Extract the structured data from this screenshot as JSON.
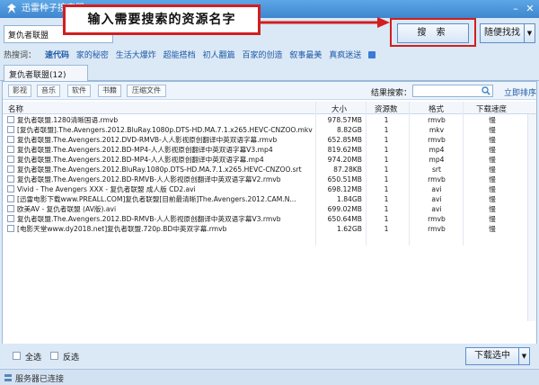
{
  "window": {
    "title": "迅雷种子搜索器",
    "minimize_icon": "minimize-icon",
    "close_icon": "close-icon"
  },
  "search": {
    "input_value": "复仇者联盟",
    "callout_text": "输入需要搜索的资源名字",
    "search_button": "搜 索",
    "random_button": "随便找找"
  },
  "hot": {
    "label": "热搜词：",
    "items": [
      "速代码",
      "家的秘密",
      "生活大爆炸",
      "超能搭档",
      "初人翻篇",
      "百家的创造",
      "叙事最美",
      "真疯迷送"
    ]
  },
  "tab": {
    "label": "复仇者联盟(12)"
  },
  "filters": {
    "buttons": [
      "影视",
      "音乐",
      "软件",
      "书籍",
      "压缩文件"
    ],
    "result_label": "结果搜索：",
    "sort_link": "立即排序"
  },
  "table": {
    "headers": {
      "name": "名称",
      "size": "大小",
      "count": "资源数",
      "format": "格式",
      "speed": "下载速度"
    },
    "rows": [
      {
        "name": "复仇者联盟.1280清晰国语.rmvb",
        "size": "978.57MB",
        "count": "1",
        "format": "rmvb",
        "speed": "慢"
      },
      {
        "name": "[复仇者联盟].The.Avengers.2012.BluRay.1080p.DTS-HD.MA.7.1.x265.HEVC-CNZOO.mkv",
        "size": "8.82GB",
        "count": "1",
        "format": "mkv",
        "speed": "慢"
      },
      {
        "name": "复仇者联盟.The.Avengers.2012.DVD-RMVB-人人影视原创翻译中英双语字幕.rmvb",
        "size": "652.85MB",
        "count": "1",
        "format": "rmvb",
        "speed": "慢"
      },
      {
        "name": "复仇者联盟.The.Avengers.2012.BD-MP4-人人影视原创翻译中英双语字幕V3.mp4",
        "size": "819.62MB",
        "count": "1",
        "format": "mp4",
        "speed": "慢"
      },
      {
        "name": "复仇者联盟.The.Avengers.2012.BD-MP4-人人影视原创翻译中英双语字幕.mp4",
        "size": "974.20MB",
        "count": "1",
        "format": "mp4",
        "speed": "慢"
      },
      {
        "name": "复仇者联盟.The.Avengers.2012.BluRay.1080p.DTS-HD.MA.7.1.x265.HEVC-CNZOO.srt",
        "size": "87.28KB",
        "count": "1",
        "format": "srt",
        "speed": "慢"
      },
      {
        "name": "复仇者联盟.The.Avengers.2012.BD-RMVB-人人影视原创翻译中英双语字幕V2.rmvb",
        "size": "650.51MB",
        "count": "1",
        "format": "rmvb",
        "speed": "慢"
      },
      {
        "name": "Vivid - The Avengers XXX - 复仇者联盟 成人版 CD2.avi",
        "size": "698.12MB",
        "count": "1",
        "format": "avi",
        "speed": "慢"
      },
      {
        "name": "[迅雷电影下载www.PREALL.COM]复仇者联盟[目前最清晰]The.Avengers.2012.CAM.N...",
        "size": "1.84GB",
        "count": "1",
        "format": "avi",
        "speed": "慢"
      },
      {
        "name": "欧美AV - 复仇者联盟 (AV版).avi",
        "size": "699.02MB",
        "count": "1",
        "format": "avi",
        "speed": "慢"
      },
      {
        "name": "复仇者联盟.The.Avengers.2012.BD-RMVB-人人影视原创翻译中英双语字幕V3.rmvb",
        "size": "650.64MB",
        "count": "1",
        "format": "rmvb",
        "speed": "慢"
      },
      {
        "name": "[电影天堂www.dy2018.net]复仇者联盟.720p.BD中英双字幕.rmvb",
        "size": "1.62GB",
        "count": "1",
        "format": "rmvb",
        "speed": "慢"
      }
    ]
  },
  "bottom": {
    "select_all": "全选",
    "invert": "反选",
    "download_button": "下载选中"
  },
  "status": {
    "text": "服务器已连接"
  },
  "colors": {
    "accent": "#3f86cf",
    "callout_border": "#d21e1e",
    "link": "#1e5aa8"
  }
}
